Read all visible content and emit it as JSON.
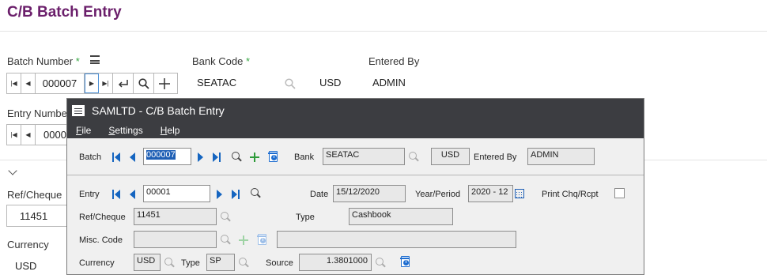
{
  "page": {
    "title": "C/B Batch Entry",
    "batch_number_label": "Batch Number",
    "required_marker": "*",
    "batch_number_value": "000007",
    "bank_code_label": "Bank Code",
    "bank_code_value": "SEATAC",
    "currency_value_top": "USD",
    "entered_by_label": "Entered By",
    "entered_by_value": "ADMIN",
    "entry_number_label": "Entry Numbe",
    "entry_number_value": "0000",
    "ref_cheque_label": "Ref/Cheque",
    "ref_cheque_value": "11451",
    "currency_label": "Currency",
    "currency_value": "USD"
  },
  "dialog": {
    "title": "SAMLTD - C/B Batch Entry",
    "menu": [
      "File",
      "Settings",
      "Help"
    ],
    "menu_hotkeys": [
      "F",
      "S",
      "H"
    ],
    "menu_rest": [
      "ile",
      "ettings",
      "elp"
    ],
    "batch_label": "Batch",
    "batch_value": "000007",
    "bank_label": "Bank",
    "bank_value": "SEATAC",
    "bank_currency": "USD",
    "entered_by_label": "Entered By",
    "entered_by_value": "ADMIN",
    "entry_label": "Entry",
    "entry_value": "00001",
    "date_label": "Date",
    "date_value": "15/12/2020",
    "year_period_label": "Year/Period",
    "year_period_value": "2020 - 12",
    "print_label": "Print Chq/Rcpt",
    "print_checked": false,
    "ref_cheque_label": "Ref/Cheque",
    "ref_cheque_value": "11451",
    "type_label": "Type",
    "type_value": "Cashbook",
    "misc_code_label": "Misc. Code",
    "misc_code_value": "",
    "misc_desc_value": "",
    "currency_label": "Currency",
    "currency_value": "USD",
    "rate_type_label": "Type",
    "rate_type_value": "SP",
    "source_label": "Source",
    "source_value": "1.3801000"
  }
}
